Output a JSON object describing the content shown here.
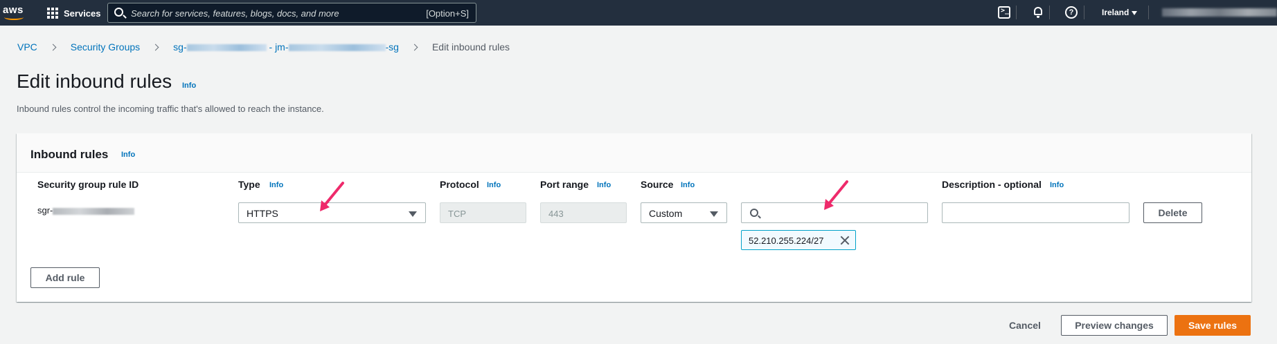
{
  "topnav": {
    "logo_text": "aws",
    "services_label": "Services",
    "search_placeholder": "Search for services, features, blogs, docs, and more",
    "search_shortcut": "[Option+S]",
    "region_label": "Ireland"
  },
  "breadcrumb": {
    "vpc": "VPC",
    "security_groups": "Security Groups",
    "sg_prefix": "sg-",
    "sg_mid": " - jm-",
    "sg_suffix": "-sg",
    "current": "Edit inbound rules"
  },
  "page": {
    "title": "Edit inbound rules",
    "title_info": "Info",
    "subtitle": "Inbound rules control the incoming traffic that's allowed to reach the instance."
  },
  "panel": {
    "title": "Inbound rules",
    "info": "Info",
    "columns": {
      "rule_id": "Security group rule ID",
      "type": "Type",
      "protocol": "Protocol",
      "port_range": "Port range",
      "source": "Source",
      "description": "Description - optional"
    },
    "col_info": "Info",
    "rule": {
      "id_prefix": "sgr-",
      "type": "HTTPS",
      "protocol": "TCP",
      "port": "443",
      "source_mode": "Custom",
      "source_search_value": "",
      "source_token": "52.210.255.224/27",
      "description_value": ""
    },
    "delete_label": "Delete",
    "add_rule_label": "Add rule"
  },
  "footer": {
    "cancel": "Cancel",
    "preview": "Preview changes",
    "save": "Save rules"
  },
  "colors": {
    "nav_bg": "#232f3e",
    "link": "#0073bb",
    "primary": "#ec7211",
    "annotation_arrow": "#ee2a6b"
  }
}
